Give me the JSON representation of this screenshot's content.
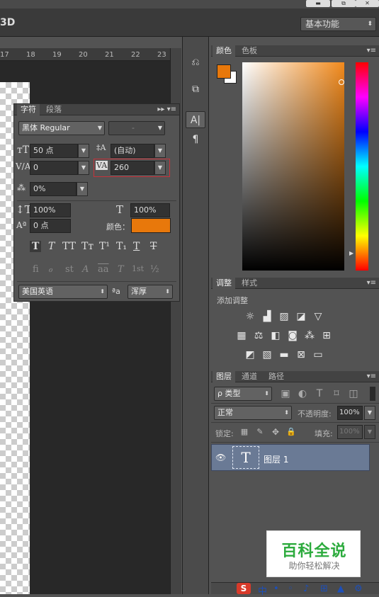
{
  "topbar": {
    "mode_label": "3D",
    "workspace": "基本功能",
    "win_buttons": [
      "▬",
      "⧉",
      "✕"
    ]
  },
  "ruler": {
    "ticks": [
      "17",
      "18",
      "19",
      "20",
      "21",
      "22",
      "23"
    ]
  },
  "character_panel": {
    "tabs": [
      "字符",
      "段落"
    ],
    "font_family": "黑体 Regular",
    "font_style": "-",
    "size": "50 点",
    "leading": "(自动)",
    "kerning": "0",
    "tracking": "260",
    "tsume": "0%",
    "vscale": "100%",
    "hscale": "100%",
    "baseline": "0 点",
    "color_label": "颜色：",
    "language": "美国英语",
    "aa_label": "ªa",
    "antialias": "浑厚",
    "style_buttons": [
      "T",
      "T",
      "TT",
      "Tт",
      "T¹",
      "T₁",
      "T",
      "T"
    ],
    "ot_buttons": [
      "fi",
      "ℴ",
      "st",
      "A",
      "aa",
      "T",
      "1st",
      "½"
    ]
  },
  "color_panel": {
    "tabs": [
      "颜色",
      "色板"
    ],
    "foreground": "#e8780b",
    "background": "#ffffff"
  },
  "adjustments_panel": {
    "tabs": [
      "调整",
      "样式"
    ],
    "title": "添加调整"
  },
  "layers_panel": {
    "tabs": [
      "图层",
      "通道",
      "路径"
    ],
    "filter": "ρ 类型",
    "blend": "正常",
    "opacity_label": "不透明度:",
    "opacity": "100%",
    "lock_label": "锁定:",
    "fill_label": "填充:",
    "fill": "100%",
    "layer_name": "图层 1",
    "layer_thumb": "T"
  },
  "watermark": {
    "line1": "百科全说",
    "line2": "助你轻松解决"
  },
  "taskbar": {
    "items": [
      "S",
      "中",
      "•",
      "◦",
      "♪",
      "⊞",
      "▲",
      "⚙"
    ]
  }
}
